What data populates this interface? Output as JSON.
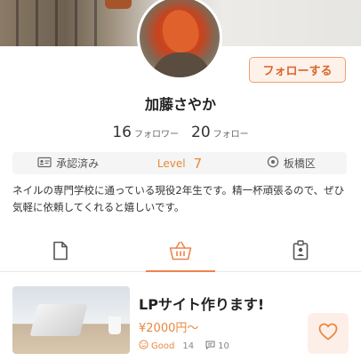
{
  "profile": {
    "name": "加藤さやか",
    "follow_button": "フォローする",
    "followers_count": "16",
    "followers_label": "フォロワー",
    "following_count": "20",
    "following_label": "フォロー",
    "verified_label": "承認済み",
    "level_label": "Level",
    "level_value": "7",
    "location": "板橋区",
    "bio": "ネイルの専門学校に通っている現役2年生です。精一杯頑張るので、ぜひ気軽に依頼してくれると嬉しいです。"
  },
  "tabs": [
    {
      "icon": "document-icon",
      "active": false
    },
    {
      "icon": "basket-icon",
      "active": true
    },
    {
      "icon": "id-badge-icon",
      "active": false
    }
  ],
  "listing": {
    "title": "LPサイト作ります!",
    "price": "¥2000円〜",
    "good_label": "Good",
    "good_count": "14",
    "comment_count": "10"
  },
  "colors": {
    "accent": "#e9883f",
    "follow_border": "#f0a06e",
    "heart_bg": "#fdefe8"
  }
}
